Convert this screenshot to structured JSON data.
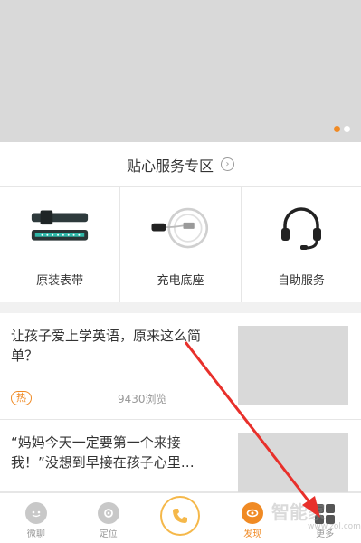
{
  "top_hint": {
    "text": ""
  },
  "banner": {
    "dots": [
      {
        "active": true
      },
      {
        "active": false
      }
    ]
  },
  "section": {
    "title": "贴心服务专区",
    "chevron": "›"
  },
  "services": [
    {
      "label": "原装表带",
      "icon": "watch-band-icon"
    },
    {
      "label": "充电底座",
      "icon": "charging-dock-icon"
    },
    {
      "label": "自助服务",
      "icon": "headset-icon"
    }
  ],
  "articles": [
    {
      "title": "让孩子爱上学英语，原来这么简单？",
      "badge": "热",
      "views": "9430浏览"
    },
    {
      "title": "“妈妈今天一定要第一个来接我！”没想到早接在孩子心里…"
    }
  ],
  "tabbar": {
    "tabs": [
      {
        "label": "微聊",
        "icon": "chat-icon",
        "active": false
      },
      {
        "label": "定位",
        "icon": "location-icon",
        "active": false
      },
      {
        "label": "",
        "icon": "phone-icon",
        "active": false
      },
      {
        "label": "发现",
        "icon": "discover-icon",
        "active": true
      },
      {
        "label": "更多",
        "icon": "grid-icon",
        "active": false
      }
    ]
  },
  "watermark": {
    "text": "智能家",
    "sub": "www.zol.com"
  },
  "colors": {
    "accent": "#f08a24",
    "placeholder": "#d9d9d9",
    "arrow": "#e8302b"
  }
}
